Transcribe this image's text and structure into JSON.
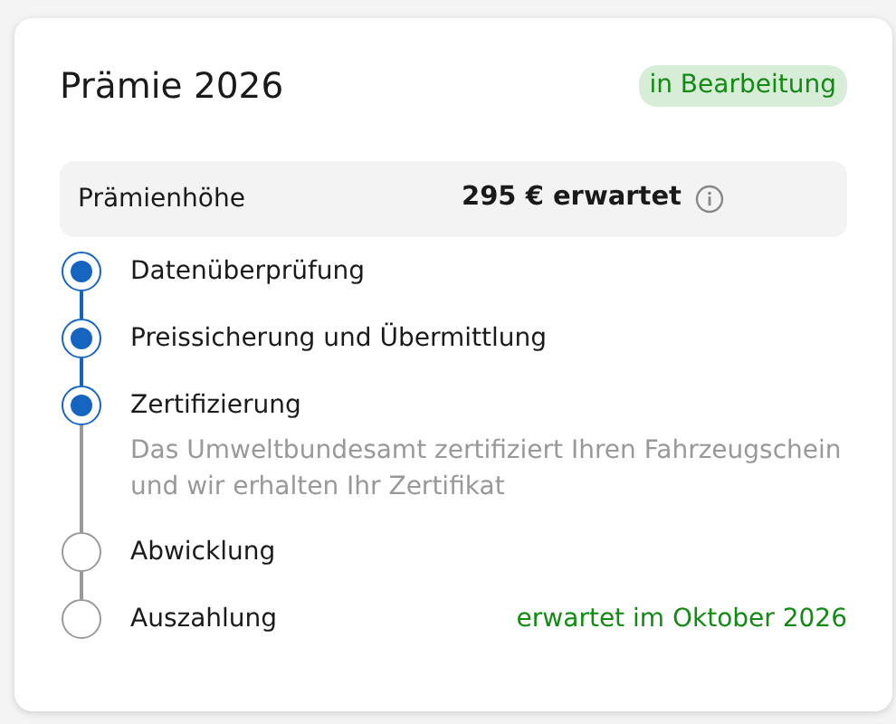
{
  "card": {
    "title": "Prämie 2026",
    "status": "in Bearbeitung"
  },
  "premium": {
    "label": "Prämienhöhe",
    "value": "295 € erwartet"
  },
  "steps": [
    {
      "label": "Datenüberprüfung",
      "done": true
    },
    {
      "label": "Preissicherung und Übermittlung",
      "done": true
    },
    {
      "label": "Zertifizierung",
      "done": true,
      "description": "Das Umweltbundesamt zertifiziert Ihren Fahrzeugschein und wir erhalten Ihr Zertifikat"
    },
    {
      "label": "Abwicklung",
      "done": false
    },
    {
      "label": "Auszahlung",
      "done": false,
      "note": "erwartet im Oktober 2026"
    }
  ]
}
